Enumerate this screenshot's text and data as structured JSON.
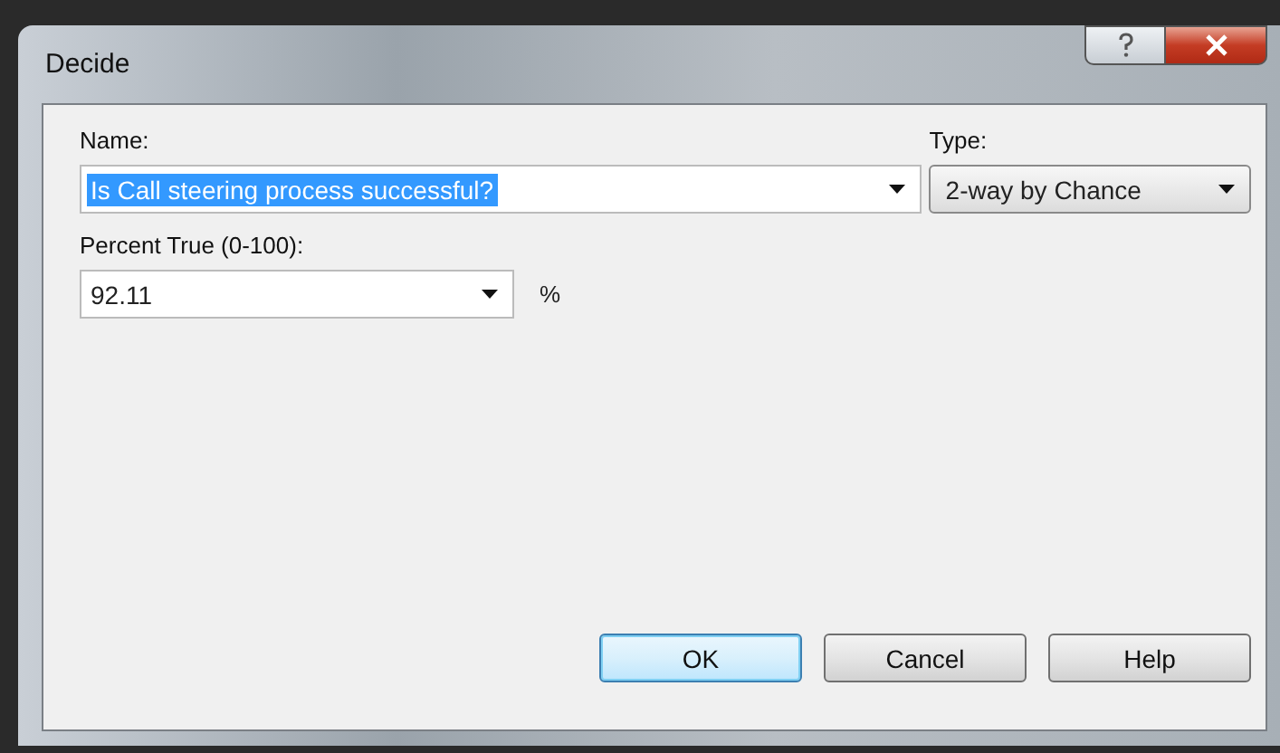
{
  "window": {
    "title": "Decide"
  },
  "name": {
    "label": "Name:",
    "value": "Is Call steering process successful?",
    "text_selected": true
  },
  "type": {
    "label": "Type:",
    "value": "2-way by Chance"
  },
  "percent": {
    "label": "Percent True (0-100):",
    "value": "92.11",
    "unit": "%"
  },
  "buttons": [
    {
      "label": "OK",
      "default": true
    },
    {
      "label": "Cancel",
      "default": false
    },
    {
      "label": "Help",
      "default": false
    }
  ]
}
